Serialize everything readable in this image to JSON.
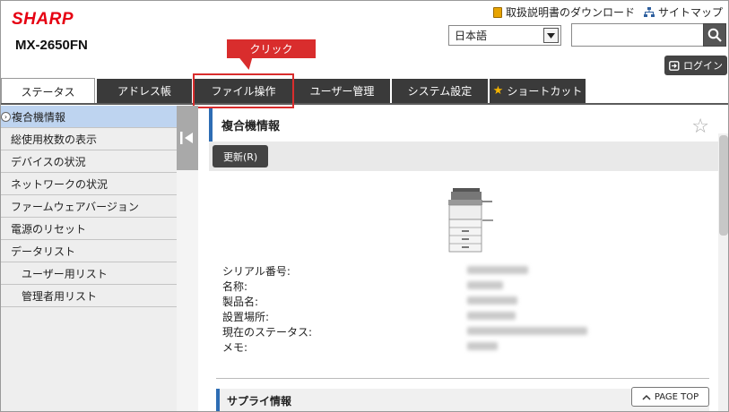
{
  "header": {
    "logo": "SHARP",
    "model": "MX-2650FN",
    "links": {
      "manual": "取扱説明書のダウンロード",
      "sitemap": "サイトマップ"
    },
    "language": "日本語",
    "search_placeholder": "",
    "login": "ログイン"
  },
  "callout": "クリック",
  "tabs": [
    {
      "label": "ステータス"
    },
    {
      "label": "アドレス帳"
    },
    {
      "label": "ファイル操作"
    },
    {
      "label": "ユーザー管理"
    },
    {
      "label": "システム設定"
    },
    {
      "label": "ショートカット"
    }
  ],
  "sidebar": {
    "items": [
      {
        "label": "複合機情報"
      },
      {
        "label": "総使用枚数の表示"
      },
      {
        "label": "デバイスの状況"
      },
      {
        "label": "ネットワークの状況"
      },
      {
        "label": "ファームウェアバージョン"
      },
      {
        "label": "電源のリセット"
      },
      {
        "label": "データリスト"
      },
      {
        "label": "ユーザー用リスト"
      },
      {
        "label": "管理者用リスト"
      }
    ]
  },
  "main": {
    "title": "複合機情報",
    "refresh": "更新(R)",
    "info": [
      {
        "label": "シリアル番号:"
      },
      {
        "label": "名称:"
      },
      {
        "label": "製品名:"
      },
      {
        "label": "設置場所:"
      },
      {
        "label": "現在のステータス:"
      },
      {
        "label": "メモ:"
      }
    ],
    "supply_title": "サプライ情報",
    "page_top": "PAGE TOP"
  },
  "icons": {
    "search": "search-icon",
    "login": "login-icon",
    "star": "star-icon",
    "favorite": "favorite-star-icon",
    "collapse": "collapse-left-icon",
    "printer": "printer-image"
  },
  "colors": {
    "brand": "#e60012",
    "accent": "#2e6db4",
    "callout": "#d92d2d",
    "tab_dark": "#3a3a3a",
    "sidebar_active": "#bed4f0"
  }
}
